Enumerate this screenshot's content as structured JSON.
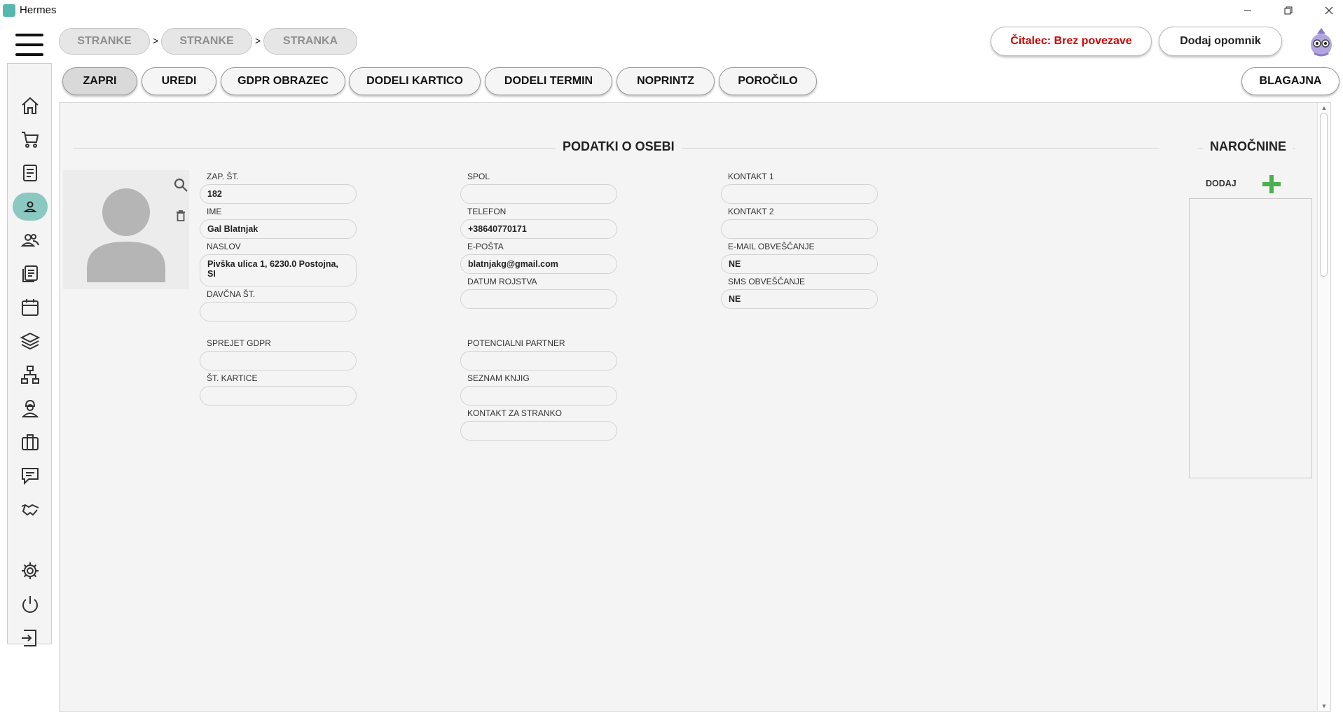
{
  "window": {
    "title": "Hermes"
  },
  "breadcrumb": {
    "items": [
      "STRANKE",
      "STRANKE",
      "STRANKA"
    ],
    "separator": ">"
  },
  "header": {
    "reader_status": "Čitalec: Brez povezave",
    "reader_status_color": "#d40000",
    "add_reminder": "Dodaj opomnik"
  },
  "tabs": [
    {
      "label": "ZAPRI",
      "active": true
    },
    {
      "label": "UREDI"
    },
    {
      "label": "GDPR OBRAZEC"
    },
    {
      "label": "DODELI KARTICO"
    },
    {
      "label": "DODELI TERMIN"
    },
    {
      "label": "NOPRINTZ"
    },
    {
      "label": "POROČILO"
    }
  ],
  "cashier_button": "BLAGAJNA",
  "sidebar": {
    "accent_color": "#8cc8c2",
    "icons": [
      "home-icon",
      "cart-icon",
      "invoice-icon",
      "user-icon",
      "users-icon",
      "documents-icon",
      "calendar-icon",
      "layers-icon",
      "network-icon",
      "worker-icon",
      "briefcase-icon",
      "chat-icon",
      "handshake-icon",
      "settings-icon",
      "power-icon",
      "logout-icon"
    ]
  },
  "person": {
    "section_title": "PODATKI O OSEBI",
    "col1": [
      {
        "label": "ZAP. ŠT.",
        "value": "182"
      },
      {
        "label": "IME",
        "value": "Gal Blatnjak"
      },
      {
        "label": "NASLOV",
        "value": "Pivška ulica 1, 6230.0 Postojna, SI"
      },
      {
        "label": "DAVČNA ŠT.",
        "value": ""
      },
      {
        "label": "SPREJET GDPR",
        "value": ""
      },
      {
        "label": "ŠT. KARTICE",
        "value": ""
      }
    ],
    "col2": [
      {
        "label": "SPOL",
        "value": ""
      },
      {
        "label": "TELEFON",
        "value": "+38640770171"
      },
      {
        "label": "E-POŠTA",
        "value": "blatnjakg@gmail.com"
      },
      {
        "label": "DATUM ROJSTVA",
        "value": ""
      },
      {
        "label": "POTENCIALNI PARTNER",
        "value": ""
      },
      {
        "label": "SEZNAM KNJIG",
        "value": ""
      },
      {
        "label": "KONTAKT ZA STRANKO",
        "value": ""
      }
    ],
    "col3": [
      {
        "label": "KONTAKT 1",
        "value": ""
      },
      {
        "label": "KONTAKT 2",
        "value": ""
      },
      {
        "label": "E-MAIL OBVEŠČANJE",
        "value": "NE"
      },
      {
        "label": "SMS OBVEŠČANJE",
        "value": "NE"
      }
    ]
  },
  "subscriptions": {
    "title": "NAROČNINE",
    "add_label": "DODAJ",
    "add_color": "#4caf50"
  }
}
